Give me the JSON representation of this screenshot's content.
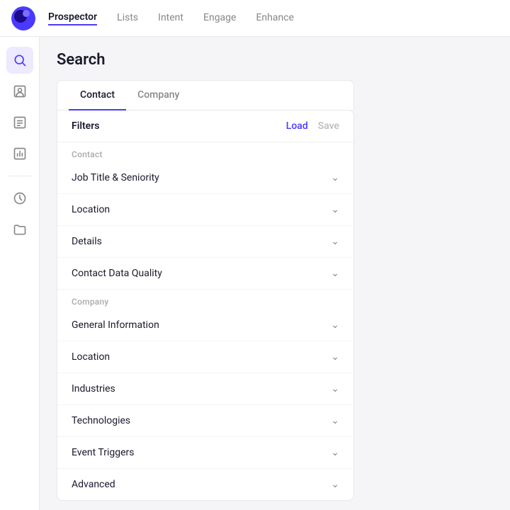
{
  "nav": {
    "logo_alt": "Prospector Logo",
    "links": [
      {
        "label": "Prospector",
        "active": true
      },
      {
        "label": "Lists",
        "active": false
      },
      {
        "label": "Intent",
        "active": false
      },
      {
        "label": "Engage",
        "active": false
      },
      {
        "label": "Enhance",
        "active": false
      }
    ]
  },
  "sidebar": {
    "icons": [
      {
        "name": "search-icon",
        "active": true,
        "glyph": "🔍"
      },
      {
        "name": "contacts-icon",
        "active": false,
        "glyph": "👤"
      },
      {
        "name": "list-icon",
        "active": false,
        "glyph": "📋"
      },
      {
        "name": "chart-icon",
        "active": false,
        "glyph": "📊"
      },
      {
        "name": "history-icon",
        "active": false,
        "glyph": "🕐"
      },
      {
        "name": "folder-icon",
        "active": false,
        "glyph": "📁"
      }
    ]
  },
  "page": {
    "title": "Search"
  },
  "tabs": [
    {
      "label": "Contact",
      "active": true
    },
    {
      "label": "Company",
      "active": false
    }
  ],
  "filters": {
    "header_label": "Filters",
    "action_load": "Load",
    "action_save": "Save",
    "contact_section": "Contact",
    "company_section": "Company",
    "contact_filters": [
      {
        "label": "Job Title & Seniority"
      },
      {
        "label": "Location"
      },
      {
        "label": "Details"
      },
      {
        "label": "Contact Data Quality"
      }
    ],
    "company_filters": [
      {
        "label": "General Information"
      },
      {
        "label": "Location"
      },
      {
        "label": "Industries"
      },
      {
        "label": "Technologies"
      },
      {
        "label": "Event Triggers"
      },
      {
        "label": "Advanced"
      }
    ]
  }
}
